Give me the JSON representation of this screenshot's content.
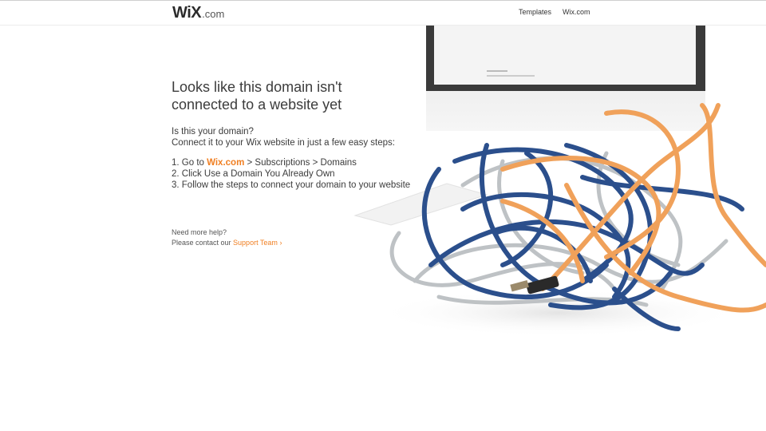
{
  "header": {
    "logo_main": "WiX",
    "logo_suffix": ".com",
    "nav_templates": "Templates",
    "nav_wixcom": "Wix.com"
  },
  "main": {
    "headline_line1": "Looks like this domain isn't",
    "headline_line2": "connected to a website yet",
    "question_line1": "Is this your domain?",
    "question_line2": "Connect it to your Wix website in just a few easy steps:",
    "step1_prefix": "1. Go to ",
    "step1_link": "Wix.com",
    "step1_suffix": " > Subscriptions > Domains",
    "step2": "2. Click Use a Domain You Already Own",
    "step3": "3. Follow the steps to connect your domain to your website",
    "help_line1": "Need more help?",
    "help_prefix": "Please contact our ",
    "support_link": "Support Team",
    "support_chevron": "›"
  },
  "colors": {
    "accent": "#f07f22",
    "cable_blue": "#2b4f8c",
    "cable_orange": "#f0a15a"
  },
  "image": {
    "semantic": "tangled-cables-with-monitor-illustration"
  }
}
